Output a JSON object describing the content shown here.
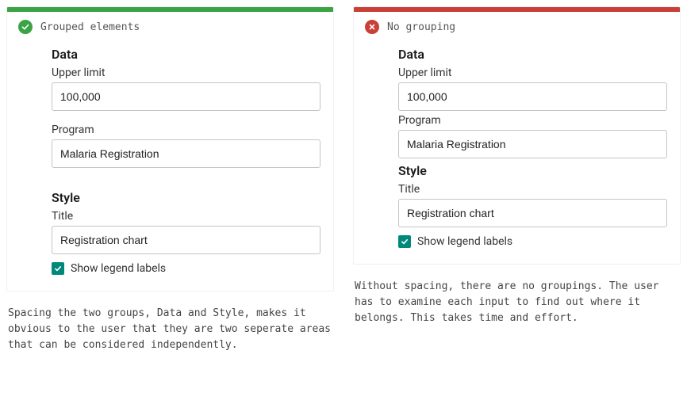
{
  "good": {
    "header_label": "Grouped elements",
    "data_section_title": "Data",
    "upper_limit_label": "Upper limit",
    "upper_limit_value": "100,000",
    "program_label": "Program",
    "program_value": "Malaria Registration",
    "style_section_title": "Style",
    "title_label": "Title",
    "title_value": "Registration chart",
    "show_legend_label": "Show legend labels",
    "caption": "Spacing the two groups, Data and Style, makes it obvious to the user that they are two seperate areas that can be considered independently."
  },
  "bad": {
    "header_label": "No grouping",
    "data_section_title": "Data",
    "upper_limit_label": "Upper limit",
    "upper_limit_value": "100,000",
    "program_label": "Program",
    "program_value": "Malaria Registration",
    "style_section_title": "Style",
    "title_label": "Title",
    "title_value": "Registration chart",
    "show_legend_label": "Show legend labels",
    "caption": "Without spacing, there are no groupings. The user has to examine each input to find out where it belongs. This takes time and effort."
  },
  "colors": {
    "good": "#3aa346",
    "bad": "#c94038",
    "checkbox": "#00897b"
  }
}
